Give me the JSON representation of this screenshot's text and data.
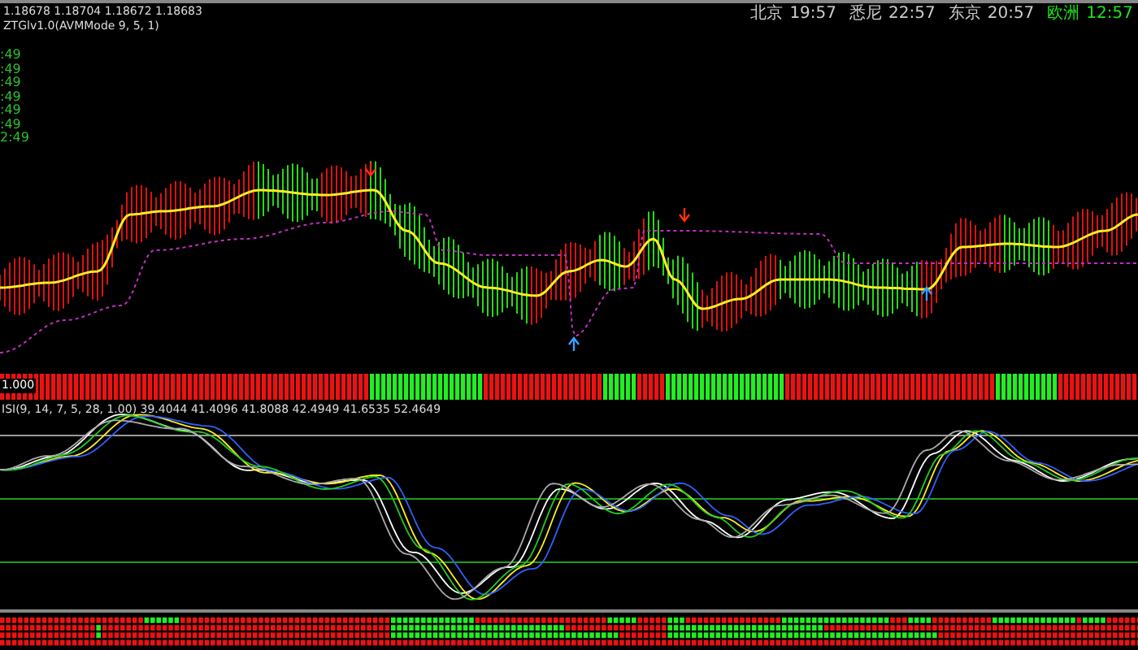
{
  "quote": {
    "prices": "1.18678 1.18704 1.18672 1.18683",
    "indicator": "ZTGlv1.0(AVMMode 9, 5, 1)"
  },
  "time_labels": [
    ":49",
    ":49",
    ":49",
    ":49",
    ":49",
    ":49",
    "2:49"
  ],
  "clocks": [
    {
      "city": "北京",
      "time": "19:57",
      "selected": false
    },
    {
      "city": "悉尼",
      "time": "22:57",
      "selected": false
    },
    {
      "city": "东京",
      "time": "20:57",
      "selected": false
    },
    {
      "city": "欧洲",
      "time": "12:57",
      "selected": true
    }
  ],
  "signal_panel": {
    "label": "1.000"
  },
  "oscillator": {
    "label": "ISI(9, 14, 7, 5, 28, 1.00) 39.4044 41.4096 41.8088 42.4949 41.6535 52.4649"
  }
}
